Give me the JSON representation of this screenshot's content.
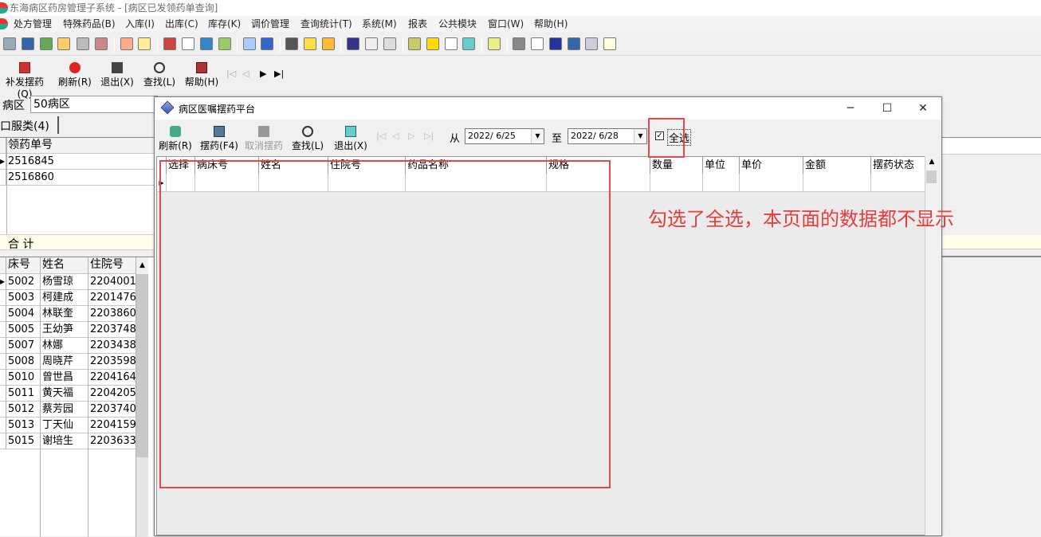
{
  "window": {
    "title": "东海病区药房管理子系统 - [病区已发领药单查询]"
  },
  "menu": [
    "处方管理",
    "特殊药品(B)",
    "入库(I)",
    "出库(C)",
    "库存(K)",
    "调价管理",
    "查询统计(T)",
    "系统(M)",
    "报表",
    "公共模块",
    "窗口(W)",
    "帮助(H)"
  ],
  "toolbar": {
    "replenish": "补发摆药(Q)",
    "refresh": "刷新(R)",
    "exit": "退出(X)",
    "find": "查找(L)",
    "help": "帮助(H)"
  },
  "ward": {
    "label": "病区",
    "value": "50病区"
  },
  "left_tab": "口服类(4)",
  "upper_grid": {
    "header": "领药单号",
    "rows": [
      "2516845",
      "2516860"
    ],
    "total_label": "合  计"
  },
  "lower_grid": {
    "headers": [
      "床号",
      "姓名",
      "住院号"
    ],
    "rows": [
      [
        "5002",
        "杨雪琼",
        "2204001"
      ],
      [
        "5003",
        "柯建成",
        "2201476"
      ],
      [
        "5004",
        "林联奎",
        "2203860"
      ],
      [
        "5005",
        "王幼笋",
        "2203748"
      ],
      [
        "5007",
        "林娜",
        "2203438"
      ],
      [
        "5008",
        "周晓芹",
        "2203598"
      ],
      [
        "5010",
        "曾世昌",
        "2204164"
      ],
      [
        "5011",
        "黄天福",
        "2204205"
      ],
      [
        "5012",
        "蔡芳园",
        "2203740"
      ],
      [
        "5013",
        "丁天仙",
        "2204159"
      ],
      [
        "5015",
        "谢培生",
        "2203633"
      ]
    ]
  },
  "dialog": {
    "title": "病区医嘱摆药平台",
    "buttons": {
      "refresh": "刷新(R)",
      "dispense": "摆药(F4)",
      "cancel_dispense": "取消摆药",
      "find": "查找(L)",
      "exit": "退出(X)"
    },
    "from_label": "从",
    "from_date": "2022/ 6/25",
    "to_label": "至",
    "to_date": "2022/ 6/28",
    "select_all_label": "全选",
    "select_all_checked": true,
    "columns": [
      "选择",
      "病床号",
      "姓名",
      "住院号",
      "药品名称",
      "规格",
      "数量",
      "单位",
      "单价",
      "金额",
      "摆药状态"
    ]
  },
  "annotation": {
    "text": "勾选了全选，本页面的数据都不显示",
    "color": "#e53c3c"
  }
}
